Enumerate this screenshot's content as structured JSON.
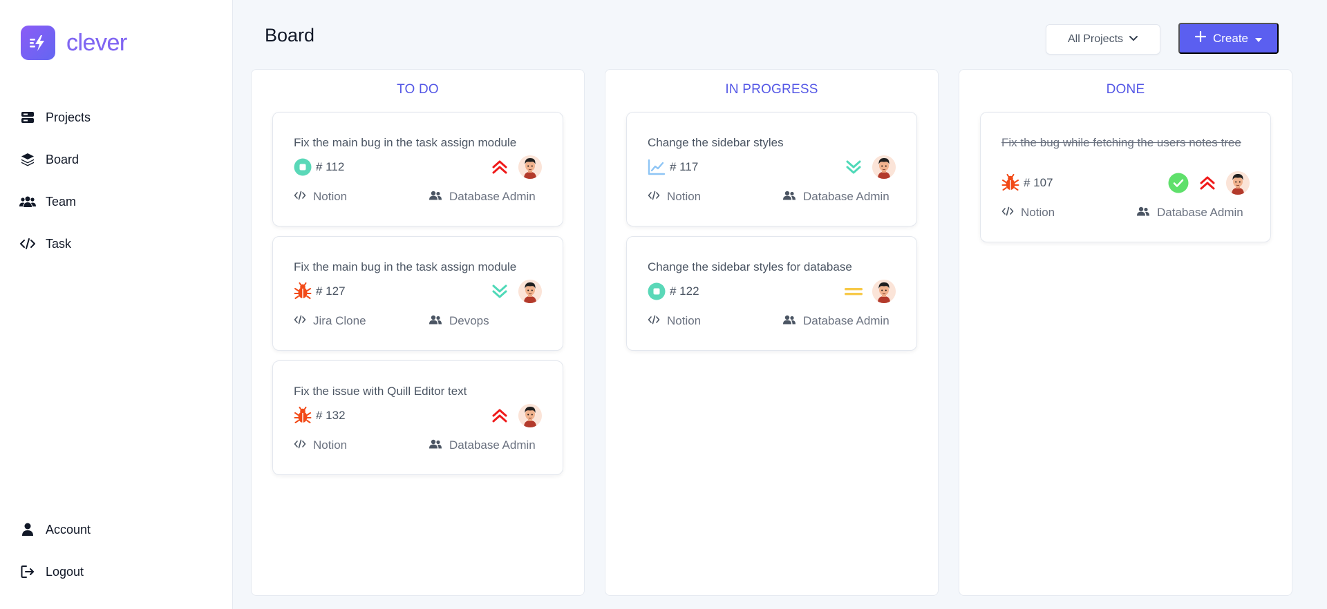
{
  "app": {
    "name": "clever"
  },
  "sidebar": {
    "items": [
      {
        "label": "Projects",
        "icon": "projects-icon"
      },
      {
        "label": "Board",
        "icon": "layers-icon"
      },
      {
        "label": "Team",
        "icon": "users-icon"
      },
      {
        "label": "Task",
        "icon": "code-icon"
      }
    ],
    "bottom": [
      {
        "label": "Account",
        "icon": "user-icon"
      },
      {
        "label": "Logout",
        "icon": "logout-icon"
      }
    ]
  },
  "header": {
    "title": "Board",
    "projects_filter": "All Projects",
    "create_label": "Create"
  },
  "colors": {
    "accent": "#5b5ff0",
    "column_title": "#5457e6",
    "priority_high": "#ef1a1a",
    "priority_low": "#4fd9b8",
    "priority_medium": "#f7c948",
    "story": "#5ad8b8",
    "bug": "#f24a17",
    "improvement": "#8ec5f5",
    "done_check": "#5fe06b"
  },
  "columns": [
    {
      "title": "TO DO",
      "cards": [
        {
          "title": "Fix the main bug in the task assign module",
          "type": "story",
          "number": "# 112",
          "priority": "high",
          "project": "Notion",
          "team": "Database Admin"
        },
        {
          "title": "Fix the main bug in the task assign module",
          "type": "bug",
          "number": "# 127",
          "priority": "low",
          "project": "Jira Clone",
          "team": "Devops"
        },
        {
          "title": "Fix the issue with Quill Editor text",
          "type": "bug",
          "number": "# 132",
          "priority": "high",
          "project": "Notion",
          "team": "Database Admin"
        }
      ]
    },
    {
      "title": "IN PROGRESS",
      "cards": [
        {
          "title": "Change the sidebar styles",
          "type": "improvement",
          "number": "# 117",
          "priority": "low",
          "project": "Notion",
          "team": "Database Admin"
        },
        {
          "title": "Change the sidebar styles for database",
          "type": "story",
          "number": "# 122",
          "priority": "medium",
          "project": "Notion",
          "team": "Database Admin"
        }
      ]
    },
    {
      "title": "DONE",
      "cards": [
        {
          "title": "Fix the bug while fetching the users notes tree",
          "type": "bug",
          "number": "# 107",
          "priority": "high",
          "project": "Notion",
          "team": "Database Admin",
          "done": true
        }
      ]
    }
  ]
}
